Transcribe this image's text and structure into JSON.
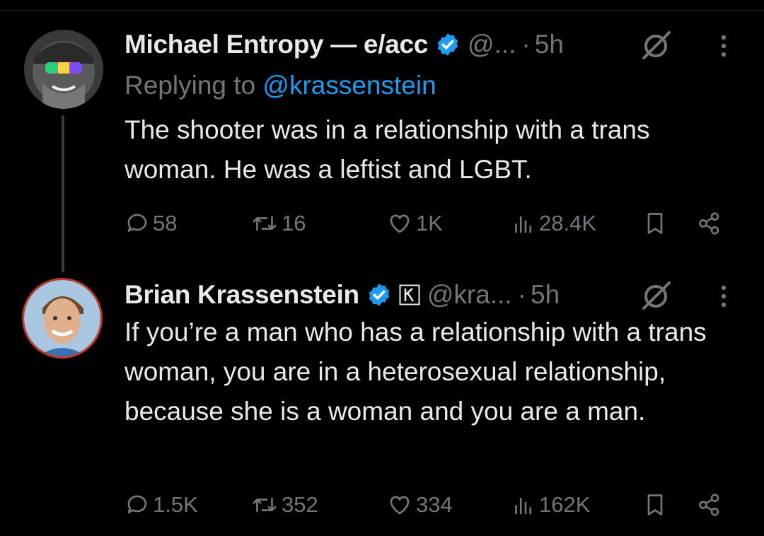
{
  "tweets": [
    {
      "name": "Michael Entropy — e/acc",
      "handle": "@...",
      "dot": "·",
      "time": "5h",
      "replying_prefix": "Replying to",
      "replying_handle": "@krassenstein",
      "body": "The shooter was in a relationship with a trans woman. He was a leftist and LGBT.",
      "stats": {
        "replies": "58",
        "retweets": "16",
        "likes": "1K",
        "views": "28.4K"
      }
    },
    {
      "name": "Brian Krassenstein",
      "handle": "@kra...",
      "dot": "·",
      "time": "5h",
      "body": "If you’re a man who has a relationship with a trans woman, you are in a heterosexual relationship, because she is a woman and you are a man.",
      "stats": {
        "replies": "1.5K",
        "retweets": "352",
        "likes": "334",
        "views": "162K"
      }
    }
  ],
  "colors": {
    "background": "#000000",
    "text": "#e7e9ea",
    "muted": "#71767b",
    "link": "#1d9bf0",
    "verified": "#1d9bf0"
  },
  "icons": [
    "verified-badge-icon",
    "k-affiliate-badge-icon",
    "grok-icon",
    "more-icon",
    "reply-icon",
    "retweet-icon",
    "like-icon",
    "views-icon",
    "bookmark-icon",
    "share-icon"
  ]
}
